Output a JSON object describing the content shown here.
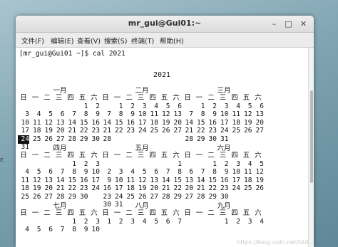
{
  "window": {
    "title": "mr_gui@Gui01:~"
  },
  "menu": [
    "文件(F)",
    "编辑(E)",
    "查看(V)",
    "搜索(S)",
    "终端(T)",
    "帮助(H)"
  ],
  "terminal": {
    "prompt": "[mr_gui@Gui01 ~]$ cal 2021",
    "year": "2021",
    "weekdays": [
      "日",
      "一",
      "二",
      "三",
      "四",
      "五",
      "六"
    ],
    "highlight": {
      "month": 0,
      "day": "24"
    },
    "months": [
      {
        "name": "一月",
        "weeks": [
          [
            "",
            "",
            "",
            "",
            "",
            "1",
            "2"
          ],
          [
            "3",
            "4",
            "5",
            "6",
            "7",
            "8",
            "9"
          ],
          [
            "10",
            "11",
            "12",
            "13",
            "14",
            "15",
            "16"
          ],
          [
            "17",
            "18",
            "19",
            "20",
            "21",
            "22",
            "23"
          ],
          [
            "24",
            "25",
            "26",
            "27",
            "28",
            "29",
            "30"
          ],
          [
            "31",
            "",
            "",
            "",
            "",
            "",
            ""
          ]
        ]
      },
      {
        "name": "二月",
        "weeks": [
          [
            "",
            "1",
            "2",
            "3",
            "4",
            "5",
            "6"
          ],
          [
            "7",
            "8",
            "9",
            "10",
            "11",
            "12",
            "13"
          ],
          [
            "14",
            "15",
            "16",
            "17",
            "18",
            "19",
            "20"
          ],
          [
            "21",
            "22",
            "23",
            "24",
            "25",
            "26",
            "27"
          ],
          [
            "28",
            "",
            "",
            "",
            "",
            "",
            ""
          ]
        ]
      },
      {
        "name": "三月",
        "weeks": [
          [
            "",
            "1",
            "2",
            "3",
            "4",
            "5",
            "6"
          ],
          [
            "7",
            "8",
            "9",
            "10",
            "11",
            "12",
            "13"
          ],
          [
            "14",
            "15",
            "16",
            "17",
            "18",
            "19",
            "20"
          ],
          [
            "21",
            "22",
            "23",
            "24",
            "25",
            "26",
            "27"
          ],
          [
            "28",
            "29",
            "30",
            "31",
            "",
            "",
            ""
          ]
        ]
      },
      {
        "name": "四月",
        "weeks": [
          [
            "",
            "",
            "",
            "",
            "1",
            "2",
            "3"
          ],
          [
            "4",
            "5",
            "6",
            "7",
            "8",
            "9",
            "10"
          ],
          [
            "11",
            "12",
            "13",
            "14",
            "15",
            "16",
            "17"
          ],
          [
            "18",
            "19",
            "20",
            "21",
            "22",
            "23",
            "24"
          ],
          [
            "25",
            "26",
            "27",
            "28",
            "29",
            "30",
            ""
          ]
        ]
      },
      {
        "name": "五月",
        "weeks": [
          [
            "",
            "",
            "",
            "",
            "",
            "",
            "1"
          ],
          [
            "2",
            "3",
            "4",
            "5",
            "6",
            "7",
            "8"
          ],
          [
            "9",
            "10",
            "11",
            "12",
            "13",
            "14",
            "15"
          ],
          [
            "16",
            "17",
            "18",
            "19",
            "20",
            "21",
            "22"
          ],
          [
            "23",
            "24",
            "25",
            "26",
            "27",
            "28",
            "29"
          ],
          [
            "30",
            "31",
            "",
            "",
            "",
            "",
            ""
          ]
        ]
      },
      {
        "name": "六月",
        "weeks": [
          [
            "",
            "",
            "1",
            "2",
            "3",
            "4",
            "5"
          ],
          [
            "6",
            "7",
            "8",
            "9",
            "10",
            "11",
            "12"
          ],
          [
            "13",
            "14",
            "15",
            "16",
            "17",
            "18",
            "19"
          ],
          [
            "20",
            "21",
            "22",
            "23",
            "24",
            "25",
            "26"
          ],
          [
            "27",
            "28",
            "29",
            "30",
            "",
            "",
            ""
          ]
        ]
      },
      {
        "name": "七月",
        "weeks": [
          [
            "",
            "",
            "",
            "",
            "1",
            "2",
            "3"
          ],
          [
            "4",
            "5",
            "6",
            "7",
            "8",
            "9",
            "10"
          ]
        ]
      },
      {
        "name": "八月",
        "weeks": [
          [
            "1",
            "2",
            "3",
            "4",
            "5",
            "6",
            "7"
          ]
        ]
      },
      {
        "name": "九月",
        "weeks": [
          [
            "",
            "",
            "",
            "1",
            "2",
            "3",
            "4"
          ]
        ]
      }
    ]
  },
  "watermark": "https://blog.csdn.net/GUI..."
}
